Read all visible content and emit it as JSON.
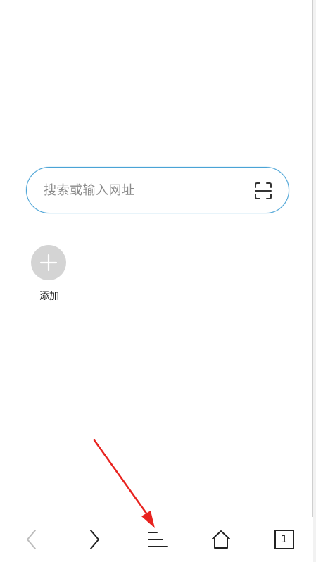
{
  "search": {
    "placeholder": "搜索或输入网址",
    "scan_icon": "scan-icon"
  },
  "shortcuts": {
    "add_label": "添加",
    "add_icon": "plus-icon"
  },
  "toolbar": {
    "back_icon": "chevron-left-icon",
    "forward_icon": "chevron-right-icon",
    "menu_icon": "menu-icon",
    "home_icon": "home-icon",
    "tabs_icon": "tabs-icon",
    "tab_count": "1"
  },
  "colors": {
    "search_border": "#4aa3d6",
    "add_circle": "#d4d4d4",
    "icon_active": "#222222",
    "icon_disabled": "#bdbdbd",
    "annotation_arrow": "#e8231f"
  }
}
